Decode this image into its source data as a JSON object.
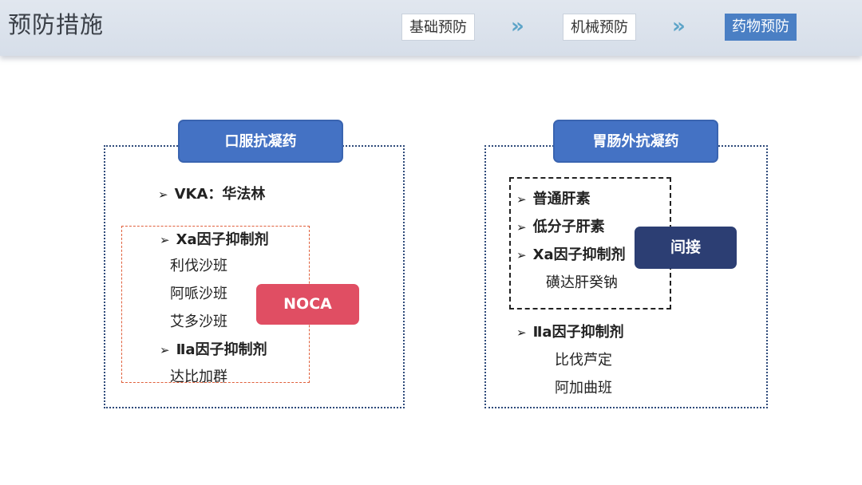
{
  "header": {
    "title": "预防措施",
    "steps": [
      {
        "label": "基础预防",
        "active": false
      },
      {
        "label": "机械预防",
        "active": false
      },
      {
        "label": "药物预防",
        "active": true
      }
    ],
    "separator": "»"
  },
  "left_panel": {
    "title": "口服抗凝药",
    "vka": "VKA：华法林",
    "xa_heading": "Xa因子抑制剂",
    "xa_drugs": [
      "利伐沙班",
      "阿哌沙班",
      "艾多沙班"
    ],
    "iia_heading": "Ⅱa因子抑制剂",
    "iia_drugs": [
      "达比加群"
    ],
    "tag": "NOCA"
  },
  "right_panel": {
    "title": "胃肠外抗凝药",
    "items": [
      "普通肝素",
      "低分子肝素",
      "Xa因子抑制剂"
    ],
    "xa_drug": "磺达肝癸钠",
    "tag": "间接",
    "iia_heading": "Ⅱa因子抑制剂",
    "iia_drugs": [
      "比伐芦定",
      "阿加曲班"
    ]
  },
  "bullet_glyph": "➢",
  "colors": {
    "header_bg": "#d6dee9",
    "accent_blue": "#4472c4",
    "active_step": "#4a7fc4",
    "noca_red": "#e04e63",
    "indirect_navy": "#2c3e73",
    "dotted_border": "#2e4a7a"
  }
}
